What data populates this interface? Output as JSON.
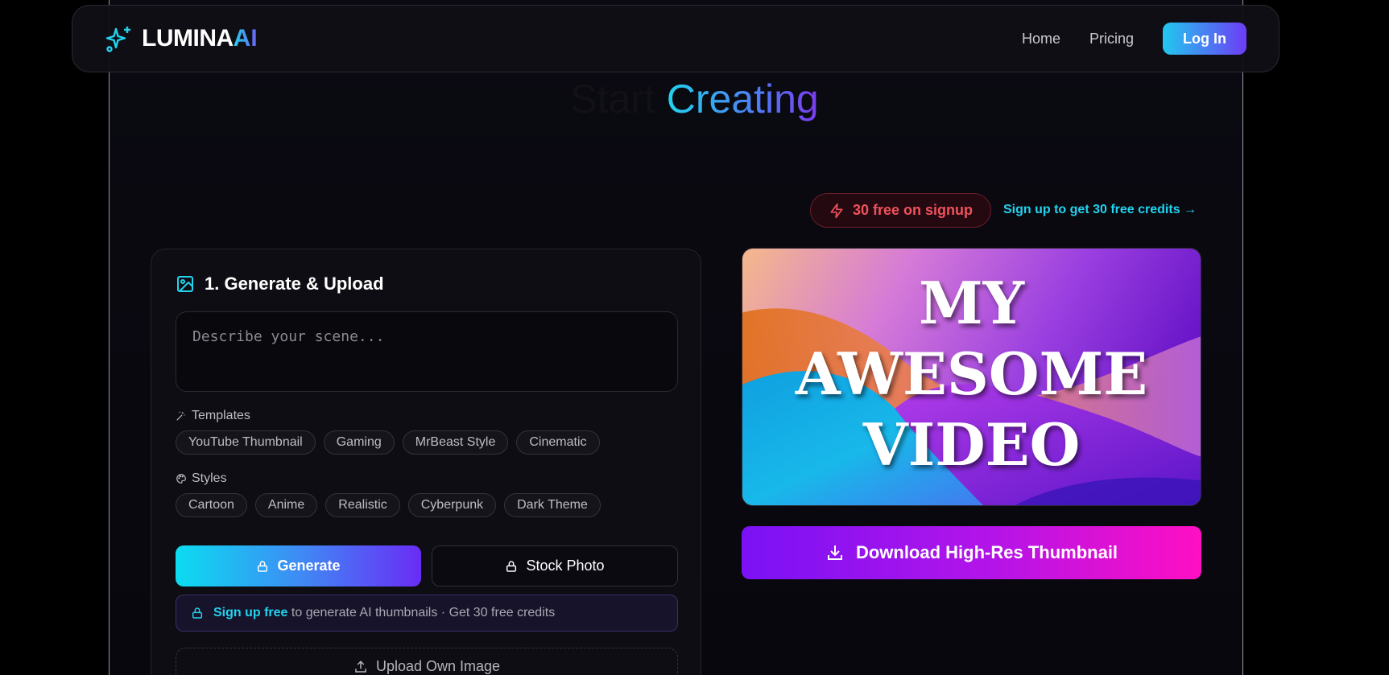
{
  "brand": {
    "name": "LUMINA",
    "accent": "AI",
    "icon": "sparkle-icon"
  },
  "nav": {
    "home": "Home",
    "pricing": "Pricing",
    "login": "Log In"
  },
  "hero": {
    "title_dim": "Start",
    "title_accent": "Creating"
  },
  "credits": {
    "badge": "30 free on signup",
    "badge_icon": "lightning-icon",
    "link": "Sign up to get 30 free credits →"
  },
  "panel": {
    "title": "1. Generate & Upload",
    "title_icon": "image-icon",
    "scene_placeholder": "Describe your scene...",
    "templates_label": "Templates",
    "templates": [
      "YouTube Thumbnail",
      "Gaming",
      "MrBeast Style",
      "Cinematic"
    ],
    "styles_label": "Styles",
    "styles": [
      "Cartoon",
      "Anime",
      "Realistic",
      "Cyberpunk",
      "Dark Theme"
    ],
    "generate_label": "Generate",
    "stock_label": "Stock Photo",
    "notice_link": "Sign up free",
    "notice_text": " to generate AI thumbnails · Get 30 free credits",
    "upload_label": "Upload Own Image"
  },
  "preview": {
    "text": "MY\nAWESOME\nVIDEO"
  },
  "download": {
    "label": "Download High-Res Thumbnail"
  },
  "colors": {
    "accent_cyan": "#22d3ee",
    "accent_purple": "#6d3cf5",
    "badge_red": "#f0525c",
    "download_pink": "#ff0fc3"
  }
}
